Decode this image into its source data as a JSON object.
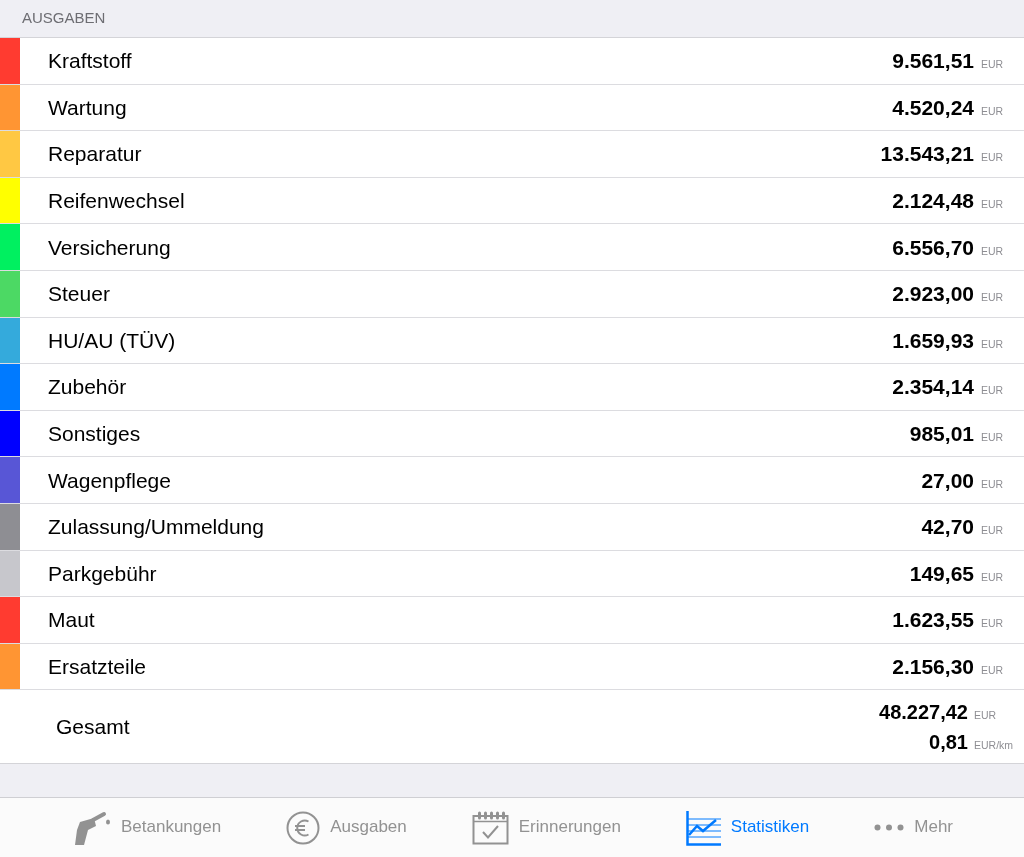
{
  "section_header": "AUSGABEN",
  "expenses": [
    {
      "name": "Kraftstoff",
      "amount": "9.561,51",
      "unit": "EUR",
      "color": "#ff3b30"
    },
    {
      "name": "Wartung",
      "amount": "4.520,24",
      "unit": "EUR",
      "color": "#ff9533"
    },
    {
      "name": "Reparatur",
      "amount": "13.543,21",
      "unit": "EUR",
      "color": "#ffc843"
    },
    {
      "name": "Reifenwechsel",
      "amount": "2.124,48",
      "unit": "EUR",
      "color": "#ffff00"
    },
    {
      "name": "Versicherung",
      "amount": "6.556,70",
      "unit": "EUR",
      "color": "#00f060"
    },
    {
      "name": "Steuer",
      "amount": "2.923,00",
      "unit": "EUR",
      "color": "#4cd964"
    },
    {
      "name": "HU/AU (TÜV)",
      "amount": "1.659,93",
      "unit": "EUR",
      "color": "#34aadc"
    },
    {
      "name": "Zubehör",
      "amount": "2.354,14",
      "unit": "EUR",
      "color": "#007aff"
    },
    {
      "name": "Sonstiges",
      "amount": "985,01",
      "unit": "EUR",
      "color": "#0000ff"
    },
    {
      "name": "Wagenpflege",
      "amount": "27,00",
      "unit": "EUR",
      "color": "#5856d6"
    },
    {
      "name": "Zulassung/Ummeldung",
      "amount": "42,70",
      "unit": "EUR",
      "color": "#8e8e93"
    },
    {
      "name": "Parkgebühr",
      "amount": "149,65",
      "unit": "EUR",
      "color": "#c7c7cc"
    },
    {
      "name": "Maut",
      "amount": "1.623,55",
      "unit": "EUR",
      "color": "#ff3b30"
    },
    {
      "name": "Ersatzteile",
      "amount": "2.156,30",
      "unit": "EUR",
      "color": "#ff9533"
    }
  ],
  "total": {
    "label": "Gesamt",
    "lines": [
      {
        "amount": "48.227,42",
        "unit": "EUR"
      },
      {
        "amount": "0,81",
        "unit": "EUR/km"
      }
    ]
  },
  "tab_bar": [
    {
      "label": "Betankungen",
      "selected": false
    },
    {
      "label": "Ausgaben",
      "selected": false
    },
    {
      "label": "Erinnerungen",
      "selected": false
    },
    {
      "label": "Statistiken",
      "selected": true
    },
    {
      "label": "Mehr",
      "selected": false
    }
  ]
}
